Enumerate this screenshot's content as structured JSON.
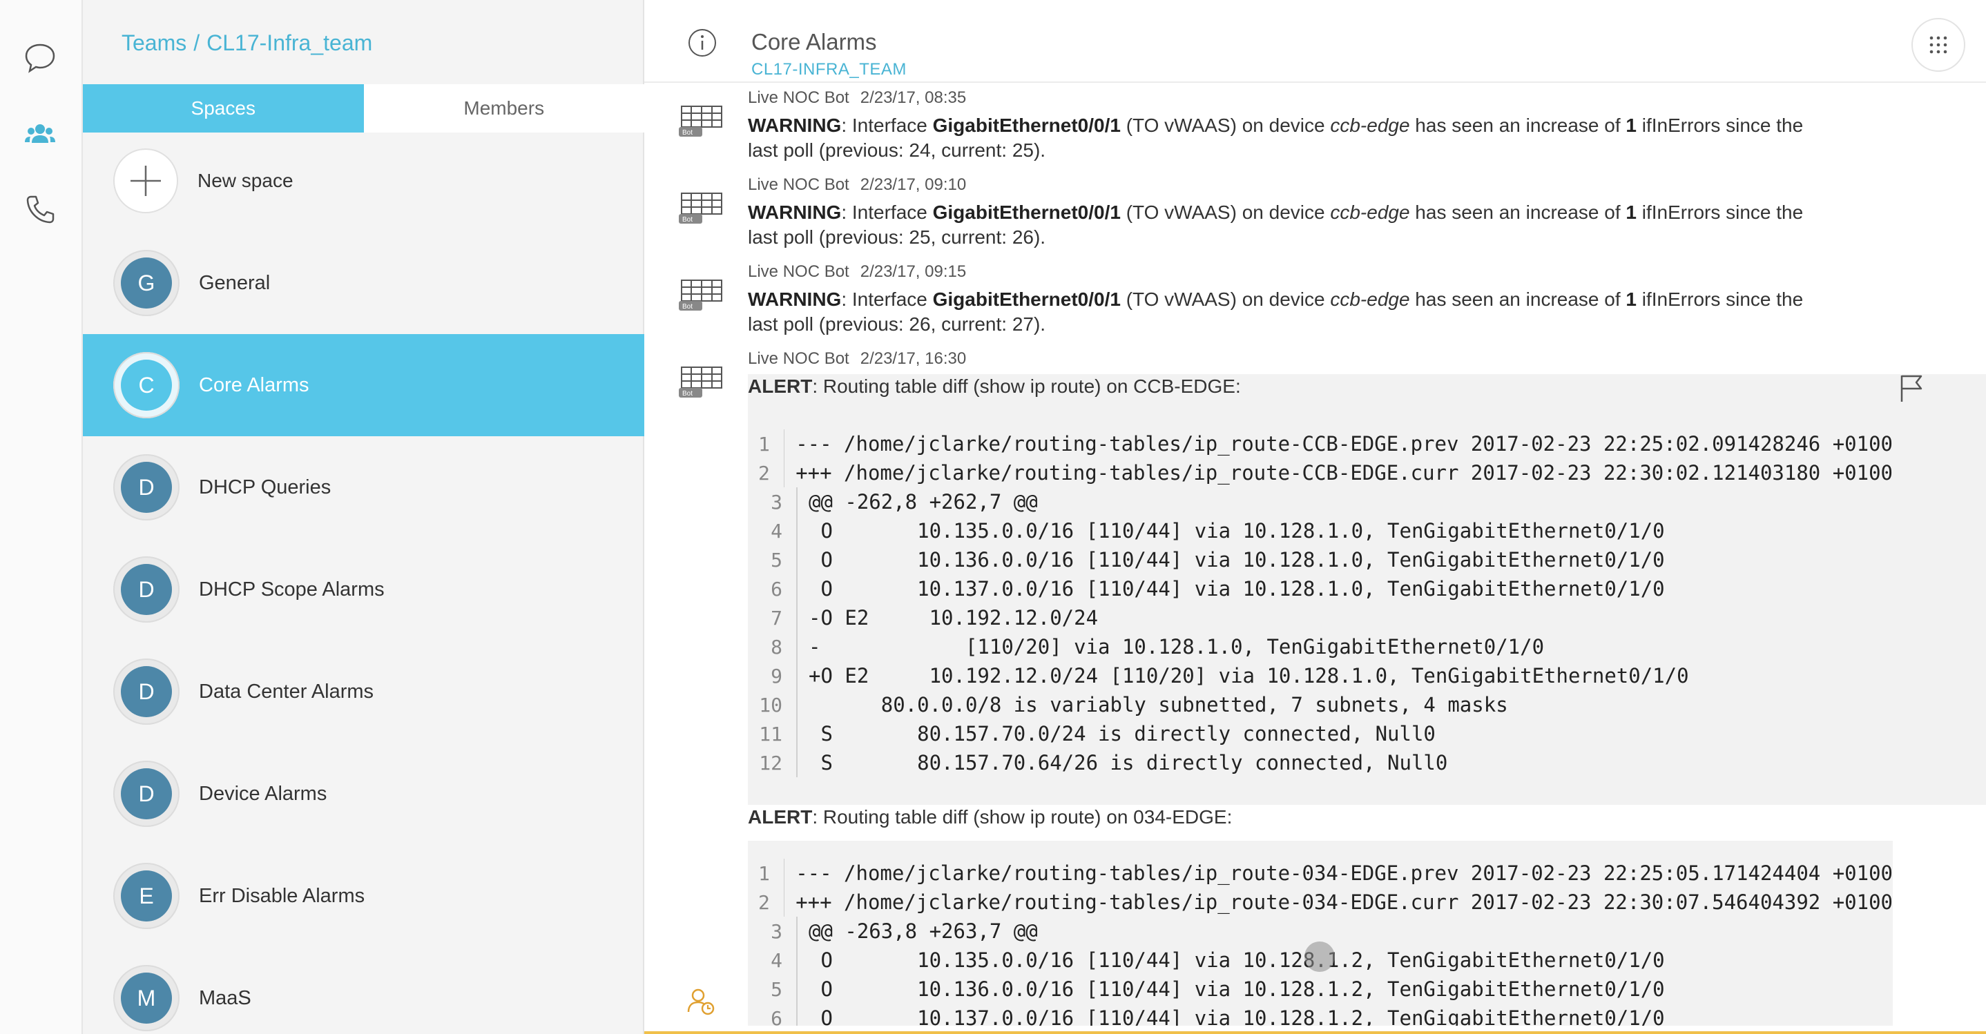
{
  "breadcrumb": {
    "root": "Teams",
    "separator": "/",
    "team": "CL17-Infra_team"
  },
  "tabs": {
    "spaces": "Spaces",
    "members": "Members"
  },
  "new_space": {
    "label": "New space"
  },
  "spaces": [
    {
      "initial": "G",
      "name": "General",
      "active": false
    },
    {
      "initial": "C",
      "name": "Core Alarms",
      "active": true
    },
    {
      "initial": "D",
      "name": "DHCP Queries",
      "active": false
    },
    {
      "initial": "D",
      "name": "DHCP Scope Alarms",
      "active": false
    },
    {
      "initial": "D",
      "name": "Data Center Alarms",
      "active": false
    },
    {
      "initial": "D",
      "name": "Device Alarms",
      "active": false
    },
    {
      "initial": "E",
      "name": "Err Disable Alarms",
      "active": false
    },
    {
      "initial": "M",
      "name": "MaaS",
      "active": false
    }
  ],
  "header": {
    "title": "Core Alarms",
    "subtitle": "CL17-INFRA_TEAM"
  },
  "messages": [
    {
      "sender": "Live NOC Bot",
      "time": "2/23/17, 08:35",
      "warn": "WARNING",
      "p1": ": Interface ",
      "iface": "GigabitEthernet0/0/1",
      "p2": " (TO vWAAS) on device ",
      "device": "ccb-edge",
      "p3": " has seen an increase of ",
      "count": "1",
      "p4": " ifInErrors since the",
      "p5": "last poll (previous: 24, current: 25)."
    },
    {
      "sender": "Live NOC Bot",
      "time": "2/23/17, 09:10",
      "warn": "WARNING",
      "p1": ": Interface ",
      "iface": "GigabitEthernet0/0/1",
      "p2": " (TO vWAAS) on device ",
      "device": "ccb-edge",
      "p3": " has seen an increase of ",
      "count": "1",
      "p4": " ifInErrors since the",
      "p5": "last poll (previous: 25, current: 26)."
    },
    {
      "sender": "Live NOC Bot",
      "time": "2/23/17, 09:15",
      "warn": "WARNING",
      "p1": ": Interface ",
      "iface": "GigabitEthernet0/0/1",
      "p2": " (TO vWAAS) on device ",
      "device": "ccb-edge",
      "p3": " has seen an increase of ",
      "count": "1",
      "p4": " ifInErrors since the",
      "p5": "last poll (previous: 26, current: 27)."
    }
  ],
  "alert_message": {
    "sender": "Live NOC Bot",
    "time": "2/23/17, 16:30",
    "alert1": {
      "label": "ALERT",
      "text": ": Routing table diff (show ip route) on CCB-EDGE:"
    },
    "code1": [
      {
        "n": "1",
        "t": "--- /home/jclarke/routing-tables/ip_route-CCB-EDGE.prev 2017-02-23 22:25:02.091428246 +0100"
      },
      {
        "n": "2",
        "t": "+++ /home/jclarke/routing-tables/ip_route-CCB-EDGE.curr 2017-02-23 22:30:02.121403180 +0100"
      },
      {
        "n": "3",
        "t": "@@ -262,8 +262,7 @@"
      },
      {
        "n": "4",
        "t": " O       10.135.0.0/16 [110/44] via 10.128.1.0, TenGigabitEthernet0/1/0"
      },
      {
        "n": "5",
        "t": " O       10.136.0.0/16 [110/44] via 10.128.1.0, TenGigabitEthernet0/1/0"
      },
      {
        "n": "6",
        "t": " O       10.137.0.0/16 [110/44] via 10.128.1.0, TenGigabitEthernet0/1/0"
      },
      {
        "n": "7",
        "t": "-O E2     10.192.12.0/24"
      },
      {
        "n": "8",
        "t": "-            [110/20] via 10.128.1.0, TenGigabitEthernet0/1/0"
      },
      {
        "n": "9",
        "t": "+O E2     10.192.12.0/24 [110/20] via 10.128.1.0, TenGigabitEthernet0/1/0"
      },
      {
        "n": "10",
        "t": "      80.0.0.0/8 is variably subnetted, 7 subnets, 4 masks"
      },
      {
        "n": "11",
        "t": " S       80.157.70.0/24 is directly connected, Null0"
      },
      {
        "n": "12",
        "t": " S       80.157.70.64/26 is directly connected, Null0"
      }
    ],
    "alert2": {
      "label": "ALERT",
      "text": ": Routing table diff (show ip route) on 034-EDGE:"
    },
    "code2": [
      {
        "n": "1",
        "t": "--- /home/jclarke/routing-tables/ip_route-034-EDGE.prev 2017-02-23 22:25:05.171424404 +0100"
      },
      {
        "n": "2",
        "t": "+++ /home/jclarke/routing-tables/ip_route-034-EDGE.curr 2017-02-23 22:30:07.546404392 +0100"
      },
      {
        "n": "3",
        "t": "@@ -263,8 +263,7 @@"
      },
      {
        "n": "4",
        "t": " O       10.135.0.0/16 [110/44] via 10.128.1.2, TenGigabitEthernet0/1/0"
      },
      {
        "n": "5",
        "t": " O       10.136.0.0/16 [110/44] via 10.128.1.2, TenGigabitEthernet0/1/0"
      },
      {
        "n": "6",
        "t": " O       10.137.0.0/16 [110/44] via 10.128.1.2, TenGigabitEthernet0/1/0"
      }
    ]
  },
  "bot_badge": "Bot",
  "colors": {
    "accent": "#56c6e8",
    "link": "#49b4d4",
    "avatar": "#4d87a8"
  }
}
